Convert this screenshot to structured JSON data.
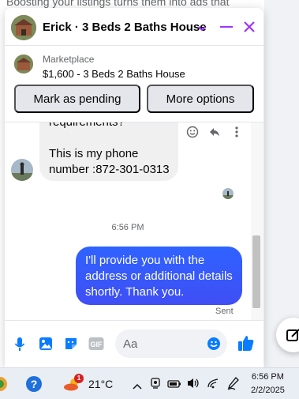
{
  "background": {
    "top_text": "Boosting your listings turns them into ads that"
  },
  "header": {
    "title": "Erick · 3 Beds 2 Baths House",
    "accent": "#a033ff"
  },
  "listing": {
    "source": "Marketplace",
    "price_title": "$1,600 - 3 Beds 2 Baths House",
    "mark_pending_label": "Mark as pending",
    "more_options_label": "More options"
  },
  "messages": {
    "incoming_line1": "requirements?",
    "incoming_line2": "This is my phone",
    "incoming_line3": "number :872-301-0313",
    "timestamp": "6:56 PM",
    "outgoing_text": "I'll provide you with the address or additional details shortly. Thank you.",
    "status": "Sent"
  },
  "composer": {
    "placeholder": "Aa",
    "value": ""
  },
  "taskbar": {
    "weather_badge": "1",
    "temperature": "21°C",
    "time": "6:56 PM",
    "date": "2/2/2025"
  },
  "colors": {
    "messenger_blue": "#0a7cff",
    "bubble_gradient_top": "#2f63ff",
    "bubble_gradient_bottom": "#3f4ef5",
    "incoming_bg": "#f0f0f0"
  }
}
